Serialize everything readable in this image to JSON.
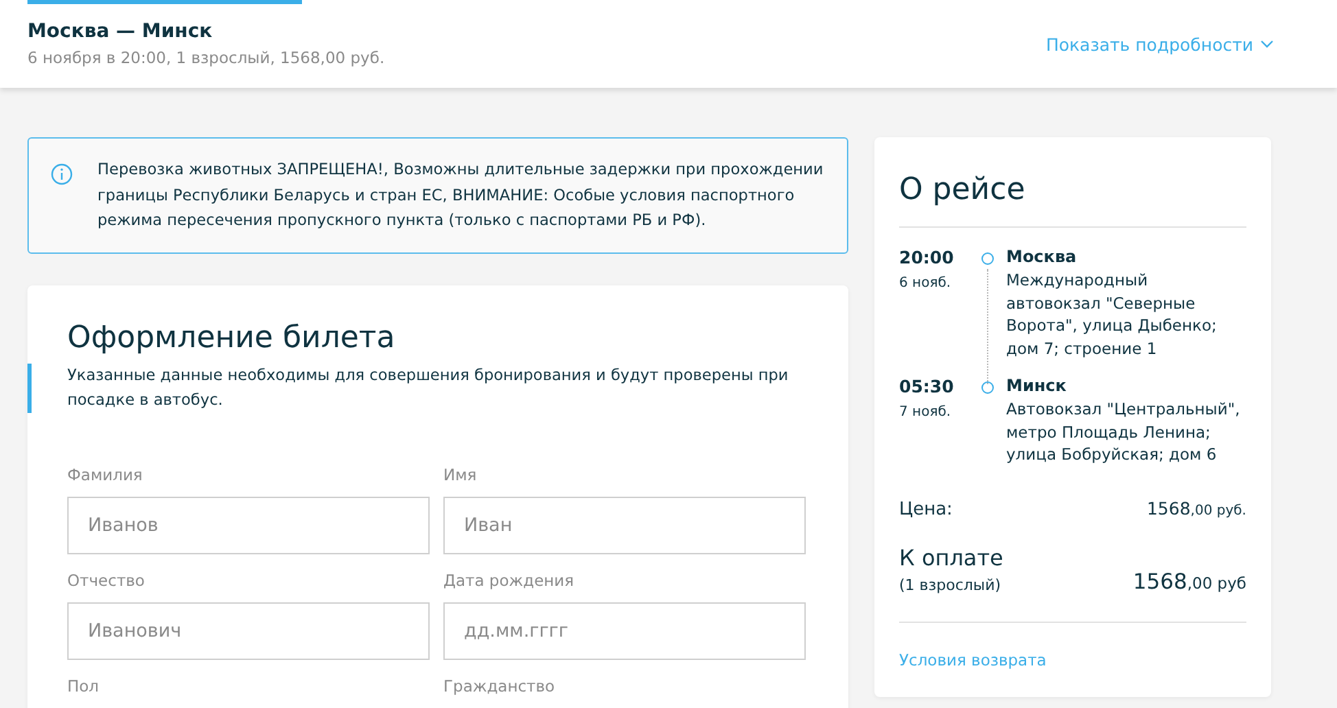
{
  "header": {
    "route": "Москва — Минск",
    "summary": "6 ноября в 20:00, 1 взрослый, 1568,00 руб.",
    "details_link": "Показать подробности"
  },
  "notice": {
    "text": "Перевозка животных ЗАПРЕЩЕНА!, Возможны длительные задержки при прохождении границы Республики Беларусь и стран ЕС, ВНИМАНИЕ: Особые условия паспортного режима пересечения пропускного пункта (только с паспортами РБ и РФ)."
  },
  "form": {
    "title": "Оформление билета",
    "subtitle": "Указанные данные необходимы для совершения бронирования и будут проверены при посадке в автобус.",
    "fields": [
      {
        "label": "Фамилия",
        "placeholder": "Иванов"
      },
      {
        "label": "Имя",
        "placeholder": "Иван"
      },
      {
        "label": "Отчество",
        "placeholder": "Иванович"
      },
      {
        "label": "Дата рождения",
        "placeholder": "дд.мм.гггг"
      },
      {
        "label": "Пол"
      },
      {
        "label": "Гражданство"
      }
    ]
  },
  "trip": {
    "title": "О рейсе",
    "stops": [
      {
        "time": "20:00",
        "date": "6 нояб.",
        "city": "Москва",
        "address": "Международный автовокзал \"Северные Ворота\", улица Дыбенко; дом 7; строение 1"
      },
      {
        "time": "05:30",
        "date": "7 нояб.",
        "city": "Минск",
        "address": "Автовокзал \"Центральный\", метро Площадь Ленина; улица Бобруйская; дом 6"
      }
    ],
    "price_label": "Цена:",
    "price_whole": "1568",
    "price_rest": ",00 руб.",
    "total_label": "К оплате",
    "total_note": "(1 взрослый)",
    "total_whole": "1568",
    "total_rest": ",00 руб",
    "refund_link": "Условия возврата"
  }
}
